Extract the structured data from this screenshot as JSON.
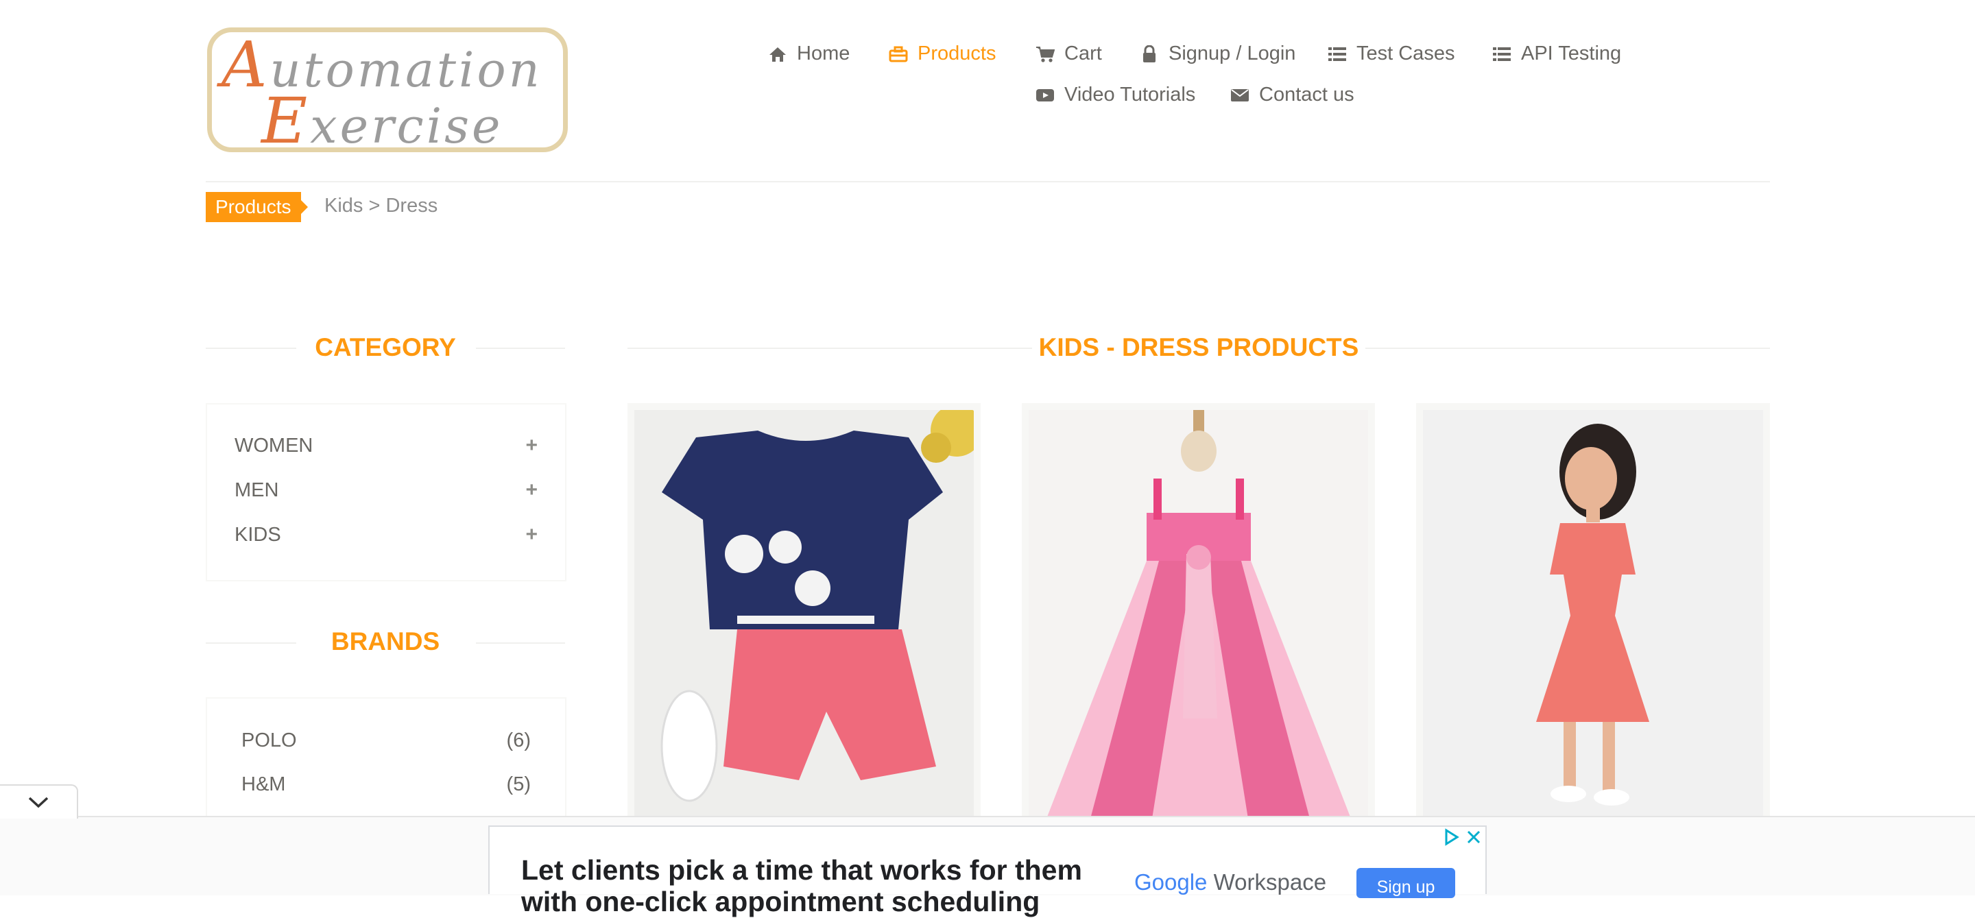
{
  "logo": {
    "line1_cap": "A",
    "line1_rest": "utomation",
    "line2_cap": "E",
    "line2_rest": "xercise"
  },
  "nav": {
    "home": "Home",
    "products": "Products",
    "cart": "Cart",
    "signup_login": "Signup / Login",
    "test_cases": "Test Cases",
    "api_testing": "API Testing",
    "video_tutorials": "Video Tutorials",
    "contact_us": "Contact us"
  },
  "breadcrumb": {
    "tag": "Products",
    "path": "Kids > Dress"
  },
  "sidebar": {
    "category_title": "CATEGORY",
    "categories": [
      {
        "label": "WOMEN",
        "toggle": "+"
      },
      {
        "label": "MEN",
        "toggle": "+"
      },
      {
        "label": "KIDS",
        "toggle": "+"
      }
    ],
    "brands_title": "BRANDS",
    "brands": [
      {
        "label": "POLO",
        "count": "(6)"
      },
      {
        "label": "H&M",
        "count": "(5)"
      }
    ]
  },
  "main": {
    "title": "KIDS - DRESS PRODUCTS"
  },
  "ad": {
    "headline": "Let clients pick a time that works for them",
    "headline_line2": "with one-click appointment scheduling",
    "brand_word": "Google",
    "brand_product": "Workspace",
    "cta": "Sign up"
  },
  "colors": {
    "accent": "#fe980f",
    "text": "#696763",
    "ad_button": "#4285f4"
  }
}
